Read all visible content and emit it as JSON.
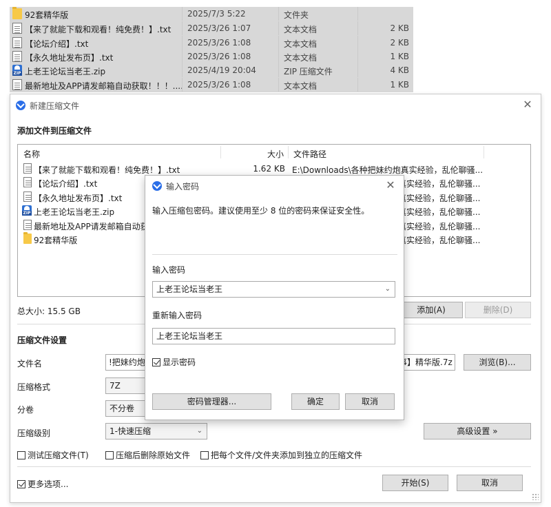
{
  "explorer": {
    "rows": [
      {
        "icon": "folder-icon",
        "name": "92套精华版",
        "date": "2025/7/3 5:22",
        "type": "文件夹",
        "size": ""
      },
      {
        "icon": "text-file-icon",
        "name": "【来了就能下载和观看！纯免费！】.txt",
        "date": "2025/3/26 1:07",
        "type": "文本文档",
        "size": "2 KB"
      },
      {
        "icon": "text-file-icon",
        "name": "【论坛介绍】.txt",
        "date": "2025/3/26 1:08",
        "type": "文本文档",
        "size": "2 KB"
      },
      {
        "icon": "text-file-icon",
        "name": "【永久地址发布页】.txt",
        "date": "2025/3/26 1:08",
        "type": "文本文档",
        "size": "1 KB"
      },
      {
        "icon": "zip-file-icon",
        "name": "上老王论坛当老王.zip",
        "date": "2025/4/19 20:04",
        "type": "ZIP 压缩文件",
        "size": "4 KB"
      },
      {
        "icon": "text-file-icon",
        "name": "最新地址及APP请发邮箱自动获取！！！....",
        "date": "2025/3/26 1:08",
        "type": "文本文档",
        "size": "1 KB"
      }
    ]
  },
  "main": {
    "title": "新建压缩文件",
    "close": "✕",
    "add_section": "添加文件到压缩文件",
    "columns": {
      "name": "名称",
      "size": "大小",
      "path": "文件路径"
    },
    "files": [
      {
        "icon": "text-file-icon",
        "name": "【来了就能下载和观看！纯免费！】.txt",
        "size": "1.62 KB",
        "path": "E:\\Downloads\\各种把妹约炮真实经验，乱伦聊骚..."
      },
      {
        "icon": "text-file-icon",
        "name": "【论坛介绍】.txt",
        "size": "",
        "path": "真实经验，乱伦聊骚..."
      },
      {
        "icon": "text-file-icon",
        "name": "【永久地址发布页】.txt",
        "size": "",
        "path": "真实经验，乱伦聊骚..."
      },
      {
        "icon": "zip-file-icon",
        "name": "上老王论坛当老王.zip",
        "size": "",
        "path": "真实经验，乱伦聊骚..."
      },
      {
        "icon": "text-file-icon",
        "name": "最新地址及APP请发邮箱自动获",
        "size": "",
        "path": "真实经验，乱伦聊骚..."
      },
      {
        "icon": "folder-icon",
        "name": "92套精华版",
        "size": "",
        "path": "真实经验，乱伦聊骚..."
      }
    ],
    "total_size": "总大小: 15.5 GB",
    "add_button": "添加(A)",
    "delete_button": "删除(D)",
    "settings_section": "压缩文件设置",
    "filename_label": "文件名",
    "filename_left": "!把妹约炮真",
    "filename_right": "事】精华版.7z",
    "browse_button": "浏览(B)...",
    "format_label": "压缩格式",
    "format_value": "7Z",
    "volume_label": "分卷",
    "volume_value": "不分卷",
    "level_label": "压缩级别",
    "level_value": "1-快速压缩",
    "advanced_button": "高级设置 »",
    "test_check": "测试压缩文件(T)",
    "delete_check": "压缩后删除原始文件",
    "separate_check": "把每个文件/文件夹添加到独立的压缩文件",
    "more_check": "更多选项...",
    "start_button": "开始(S)",
    "cancel_button": "取消"
  },
  "dialog": {
    "title": "输入密码",
    "close": "✕",
    "description": "输入压缩包密码。建议使用至少 8 位的密码来保证安全性。",
    "password_label": "输入密码",
    "password_value": "上老王论坛当老王",
    "repeat_label": "重新输入密码",
    "repeat_value": "上老王论坛当老王",
    "show_password": "显示密码",
    "manager_button": "密码管理器...",
    "ok_button": "确定",
    "cancel_button": "取消"
  }
}
